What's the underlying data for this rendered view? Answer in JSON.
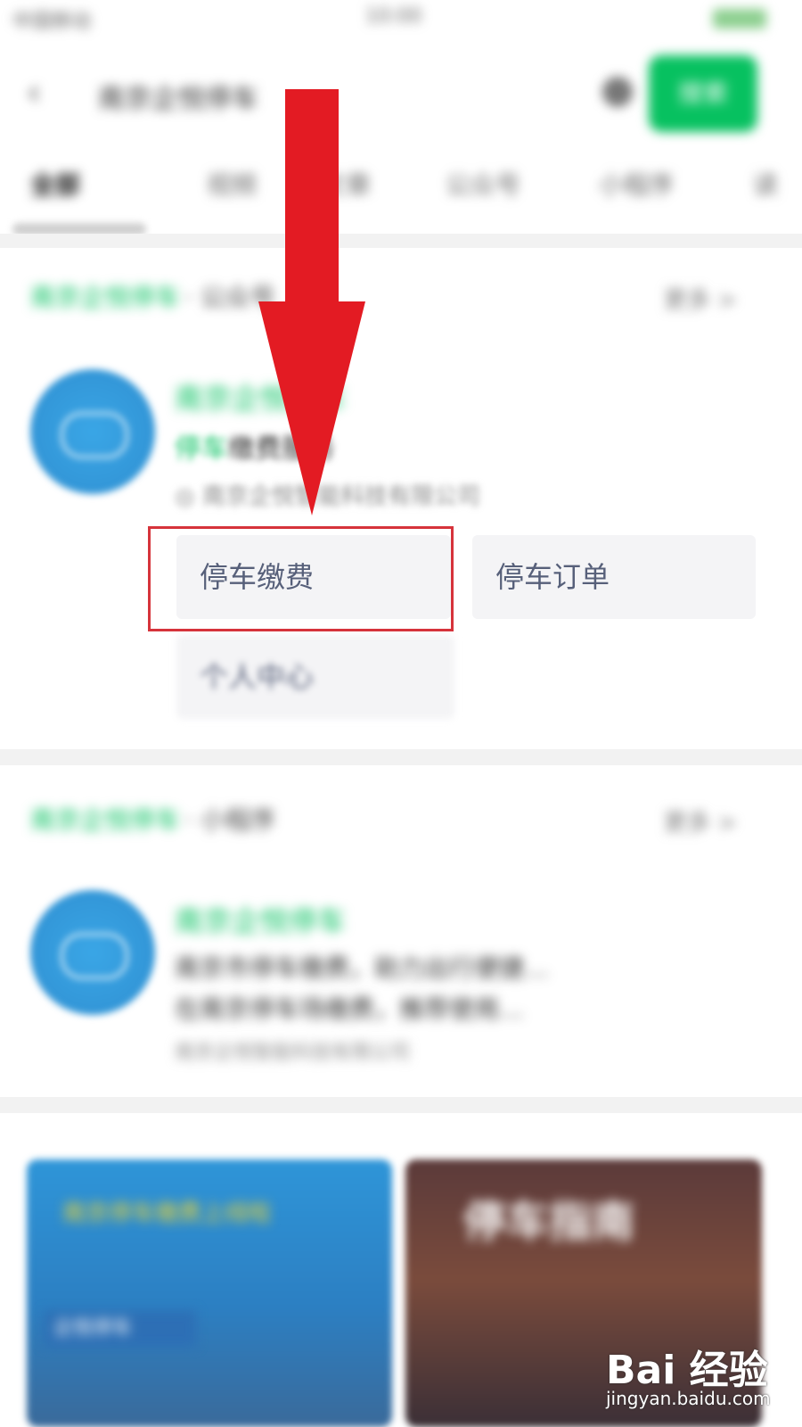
{
  "status_bar": {
    "carrier": "中国移动",
    "time": "10:00",
    "battery": "100"
  },
  "search": {
    "query": "南京企悦停车",
    "button_label": "搜索"
  },
  "tabs": [
    {
      "label": "全部",
      "active": true
    },
    {
      "label": "视频"
    },
    {
      "label": "文章"
    },
    {
      "label": "公众号"
    },
    {
      "label": "小程序"
    },
    {
      "label": "读"
    }
  ],
  "section1": {
    "title_green": "南京企悦停车",
    "title_grey": "· 公众号",
    "more": "更多 >"
  },
  "card1": {
    "name": "南京企悦停车",
    "desc_highlight": "停车",
    "desc_rest": "缴费服务",
    "org": "◎ 南京企悦智能科技有限公司"
  },
  "services": {
    "pay": "停车缴费",
    "orders": "停车订单",
    "profile": "个人中心"
  },
  "section2": {
    "title_green": "南京企悦停车",
    "title_grey": "· 小程序",
    "more": "更多 >"
  },
  "card2": {
    "name": "南京企悦停车",
    "line1": "南京市停车缴费，助力出行便捷…",
    "line2": "在南京停车场缴费，推荐使用…",
    "org": "南京企悦智能科技有限公司"
  },
  "thumb1": {
    "headline": "南京停车缴费上线啦",
    "tag": "企悦停车"
  },
  "thumb2": {
    "headline": "停车指南"
  },
  "watermark": {
    "brand": "Bai 经验",
    "url": "jingyan.baidu.com"
  },
  "colors": {
    "accent_green": "#07c160",
    "annotation_red": "#e31b23",
    "highlight_border": "#d6333b"
  }
}
